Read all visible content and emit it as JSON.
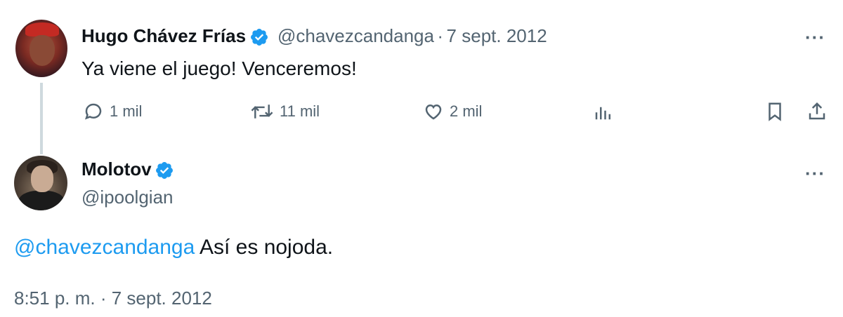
{
  "original_tweet": {
    "author_name": "Hugo Chávez Frías",
    "handle": "@chavezcandanga",
    "separator": "·",
    "date": "7 sept. 2012",
    "text": "Ya viene el juego! Venceremos!",
    "more": "···",
    "stats": {
      "replies": "1 mil",
      "retweets": "11 mil",
      "likes": "2 mil"
    }
  },
  "reply_tweet": {
    "author_name": "Molotov",
    "handle": "@ipoolgian",
    "more": "···",
    "mention": "@chavezcandanga",
    "text": " Así es nojoda.",
    "timestamp": "8:51 p. m. · 7 sept. 2012"
  },
  "colors": {
    "verified": "#1d9bf0",
    "mention": "#1d9bf0",
    "muted": "#536471",
    "thread_line": "#cfd9de"
  },
  "icons": {
    "verified": "verified-badge-icon",
    "reply": "reply-icon",
    "retweet": "retweet-icon",
    "like": "heart-icon",
    "views": "views-icon",
    "bookmark": "bookmark-icon",
    "share": "share-icon",
    "more": "more-icon"
  }
}
